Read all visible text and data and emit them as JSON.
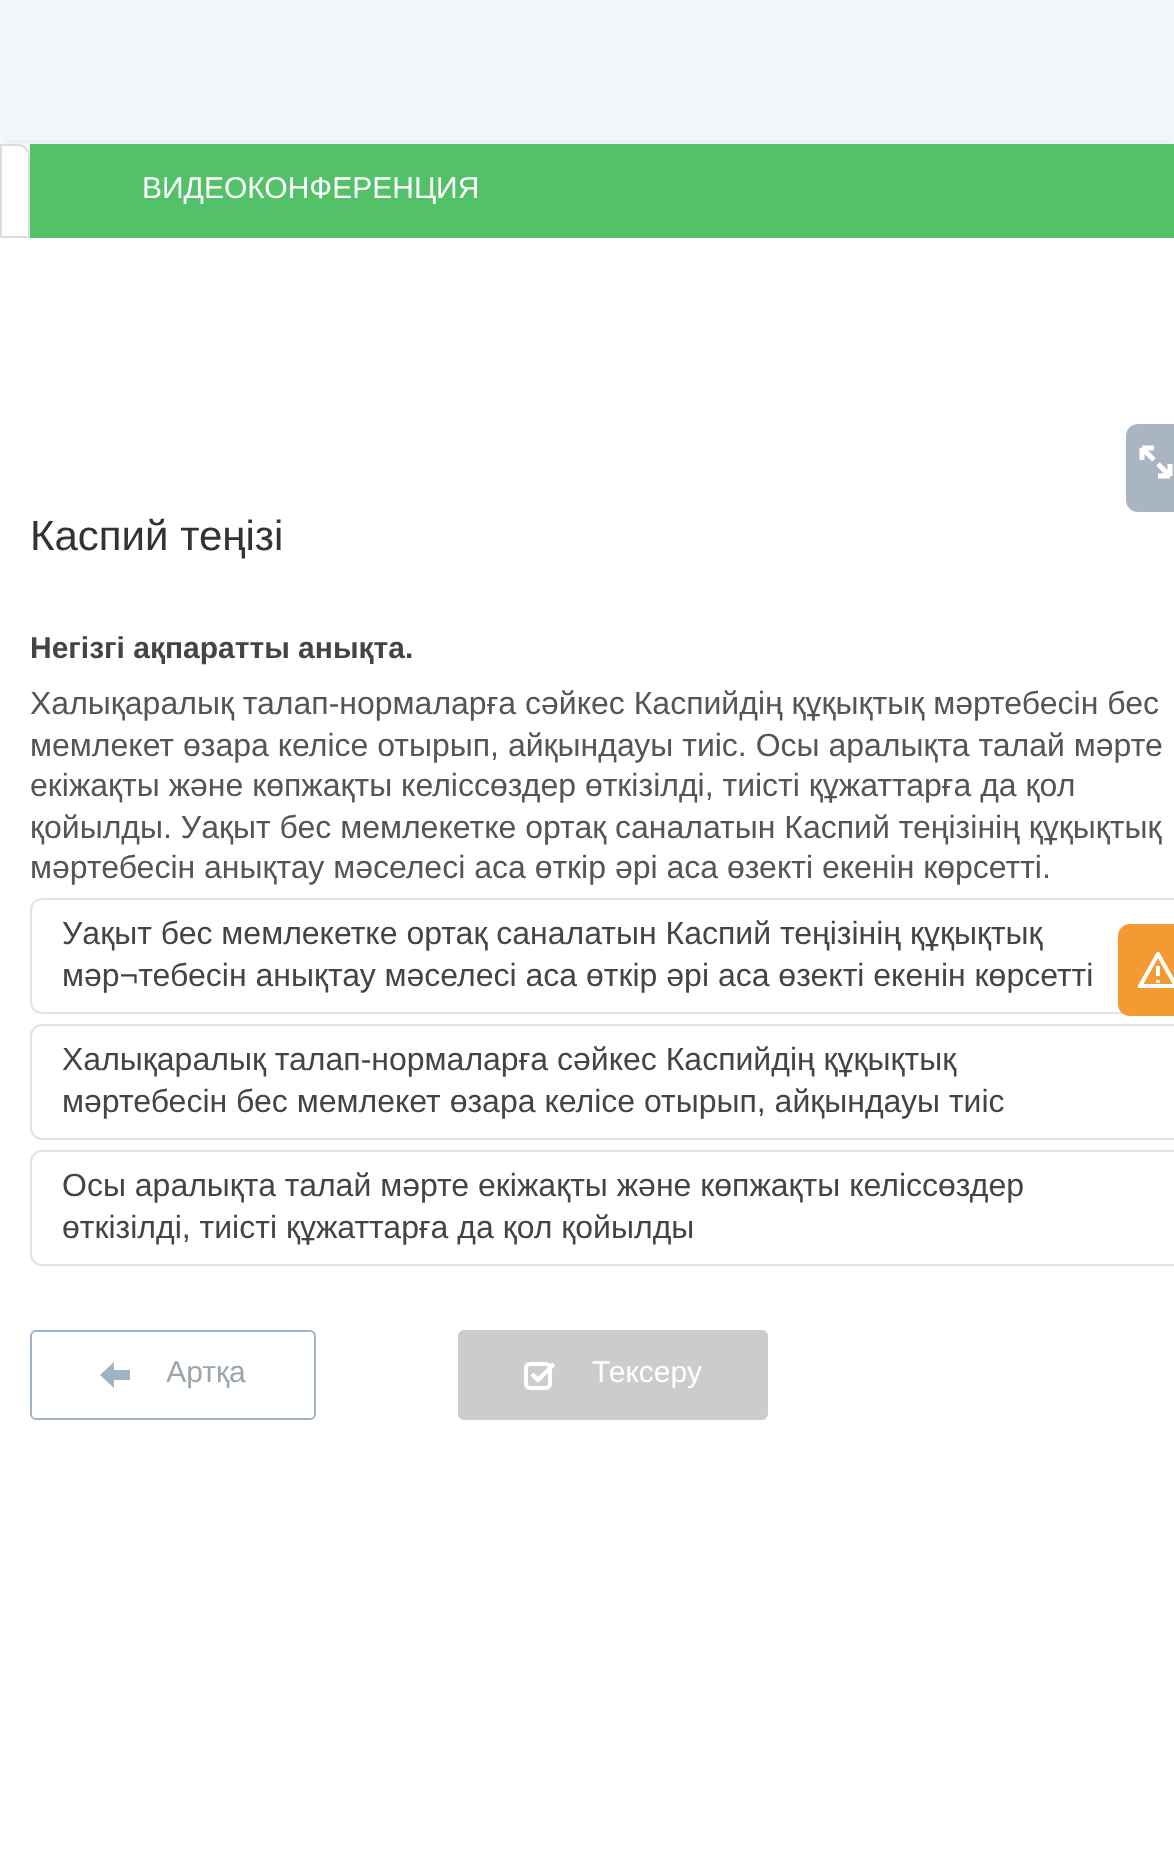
{
  "tab_bar": {
    "label": "ВИДЕОКОНФЕРЕНЦИЯ"
  },
  "title": "Каспий теңізі",
  "instruction": "Негізгі ақпаратты анықта.",
  "passage": "Халықаралық талап-нормаларға сәйкес Каспийдің құқықтық мәртебесін бес мемлекет өзара келісе отырып, айқындауы тиіс. Осы аралықта талай мәрте екіжақты және көпжақты келіссөздер өткізілді, тиісті құжаттарға да қол қойылды. Уақыт бес мемлекетке ортақ саналатын Каспий теңізінің құқықтық мәртебесін анықтау мәселесі аса өткір әрі аса өзекті екенін көрсетті.",
  "options": [
    {
      "text": "Уақыт бес мемлекетке ортақ саналатын Каспий теңізінің құқықтық мәр¬тебесін анықтау мәселесі аса өткір әрі аса өзекті екенін көрсетті",
      "warning": true
    },
    {
      "text": "Халықаралық талап-нормаларға сәйкес Каспийдің құқықтық мәртебесін бес мемлекет өзара келісе отырып, айқындауы тиіс",
      "warning": false
    },
    {
      "text": "Осы аралықта талай мәрте екіжақты және көпжақты келіссөздер өткізілді, тиісті құжаттарға да қол қойылды",
      "warning": false
    }
  ],
  "buttons": [
    {
      "kind": "back",
      "label": "Артқа",
      "disabled": false
    },
    {
      "kind": "check",
      "label": "Тексеру",
      "disabled": true
    }
  ]
}
